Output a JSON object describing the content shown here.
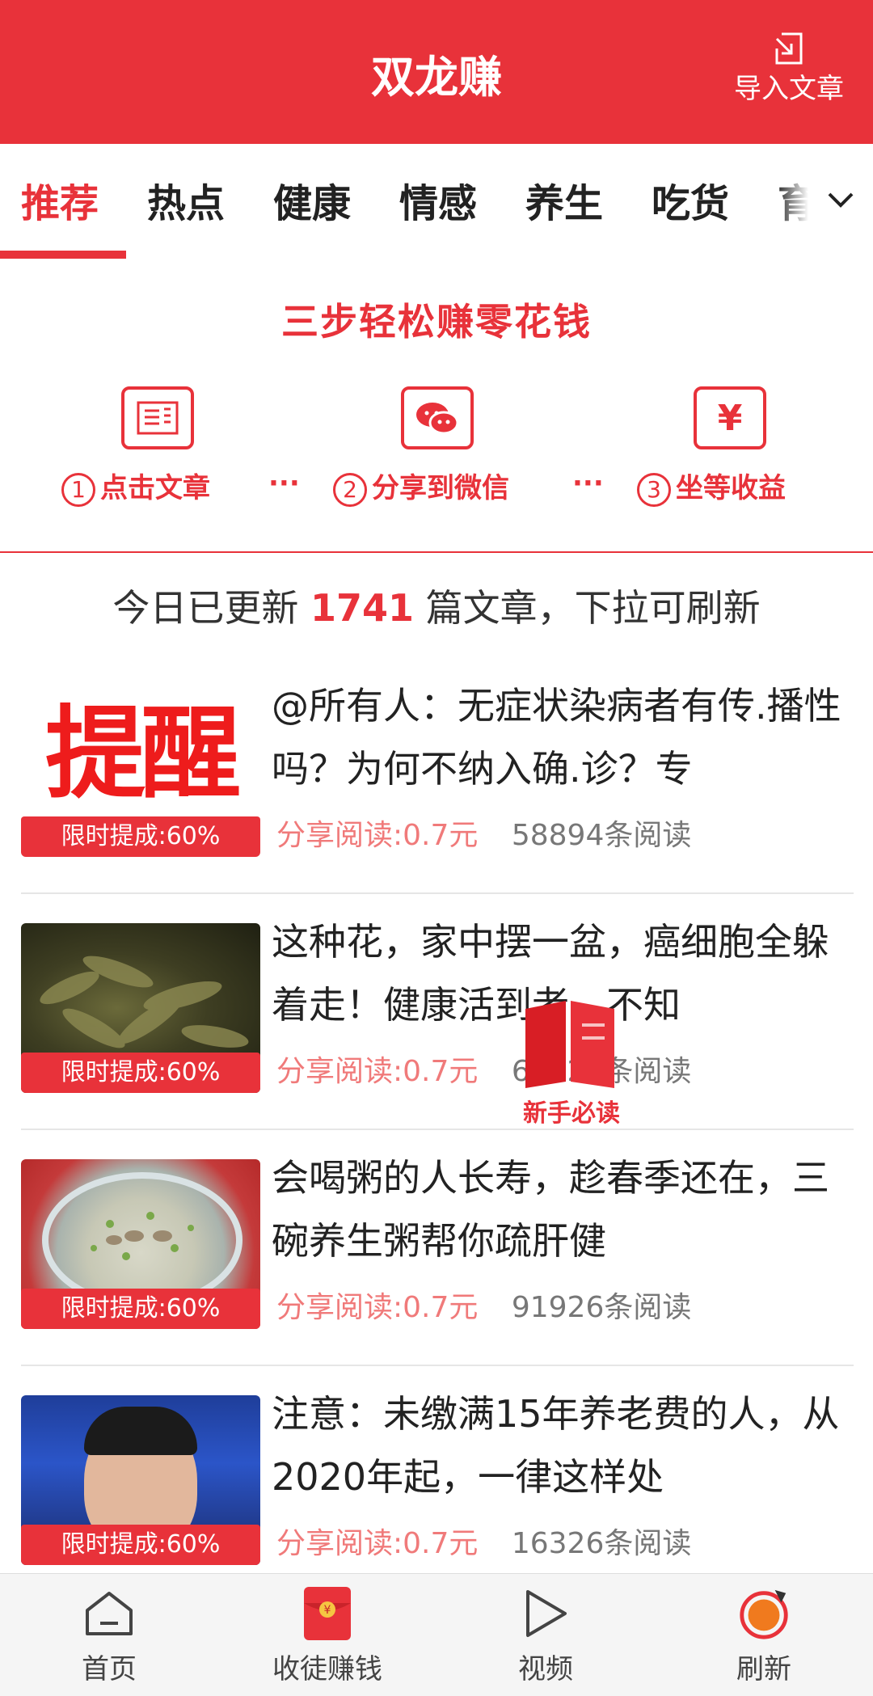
{
  "header": {
    "title": "双龙赚",
    "import_label": "导入文章"
  },
  "tabs": [
    {
      "label": "推荐",
      "active": true
    },
    {
      "label": "热点",
      "active": false
    },
    {
      "label": "健康",
      "active": false
    },
    {
      "label": "情感",
      "active": false
    },
    {
      "label": "养生",
      "active": false
    },
    {
      "label": "吃货",
      "active": false
    },
    {
      "label": "育",
      "active": false
    }
  ],
  "steps": {
    "title": "三步轻松赚零花钱",
    "items": [
      {
        "num": "1",
        "label": "点击文章",
        "icon": "article-icon"
      },
      {
        "num": "2",
        "label": "分享到微信",
        "icon": "wechat-icon"
      },
      {
        "num": "3",
        "label": "坐等收益",
        "icon": "yuan-icon"
      }
    ],
    "separator": "···"
  },
  "update": {
    "prefix": "今日已更新",
    "count": "1741",
    "suffix": "篇文章，下拉可刷新"
  },
  "articles": [
    {
      "thumb_text": "提醒",
      "badge": "限时提成:60%",
      "title": "@所有人：无症状染病者有传.播性吗？为何不纳入确.诊？专",
      "earn": "分享阅读:0.7元",
      "reads": "58894条阅读"
    },
    {
      "badge": "限时提成:60%",
      "title": "这种花，家中摆一盆，癌细胞全躲着走！健康活到老，不知",
      "earn": "分享阅读:0.7元",
      "reads": "68723条阅读"
    },
    {
      "badge": "限时提成:60%",
      "title": " 会喝粥的人长寿，趁春季还在，三碗养生粥帮你疏肝健",
      "earn": "分享阅读:0.7元",
      "reads": "91926条阅读"
    },
    {
      "badge": "限时提成:60%",
      "title": "注意：未缴满15年养老费的人，从2020年起，一律这样处",
      "earn": "分享阅读:0.7元",
      "reads": "16326条阅读"
    }
  ],
  "newbie": {
    "label": "新手必读"
  },
  "bottom_nav": [
    {
      "label": "首页",
      "icon": "home-icon"
    },
    {
      "label": "收徒赚钱",
      "icon": "red-envelope-icon"
    },
    {
      "label": "视频",
      "icon": "play-icon"
    },
    {
      "label": "刷新",
      "icon": "refresh-icon"
    }
  ],
  "colors": {
    "accent": "#e8323a",
    "earn": "#f07a7a",
    "nav_bg": "#f5f5f5"
  }
}
